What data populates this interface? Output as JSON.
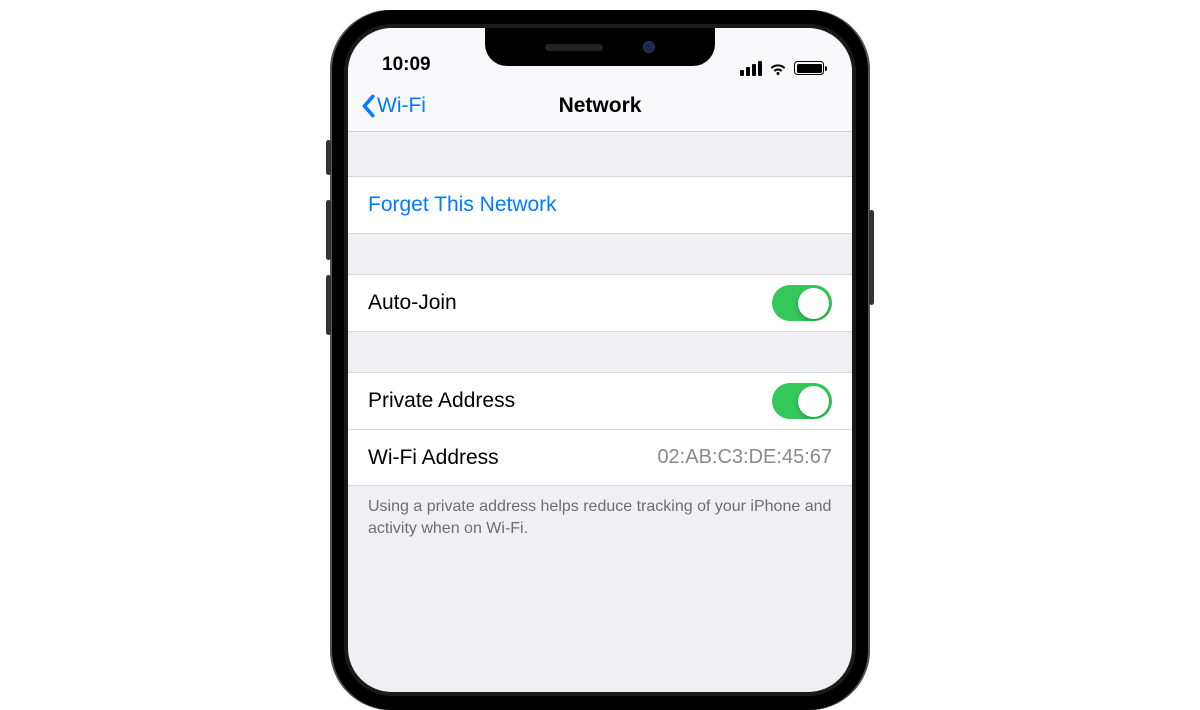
{
  "status_bar": {
    "time": "10:09"
  },
  "nav": {
    "back_label": "Wi-Fi",
    "title": "Network"
  },
  "actions": {
    "forget_label": "Forget This Network"
  },
  "settings": {
    "auto_join": {
      "label": "Auto-Join",
      "enabled": true
    },
    "private_address": {
      "label": "Private Address",
      "enabled": true
    },
    "wifi_address": {
      "label": "Wi-Fi Address",
      "value": "02:AB:C3:DE:45:67"
    }
  },
  "footer": {
    "private_note": "Using a private address helps reduce tracking of your iPhone and activity when on Wi-Fi."
  }
}
